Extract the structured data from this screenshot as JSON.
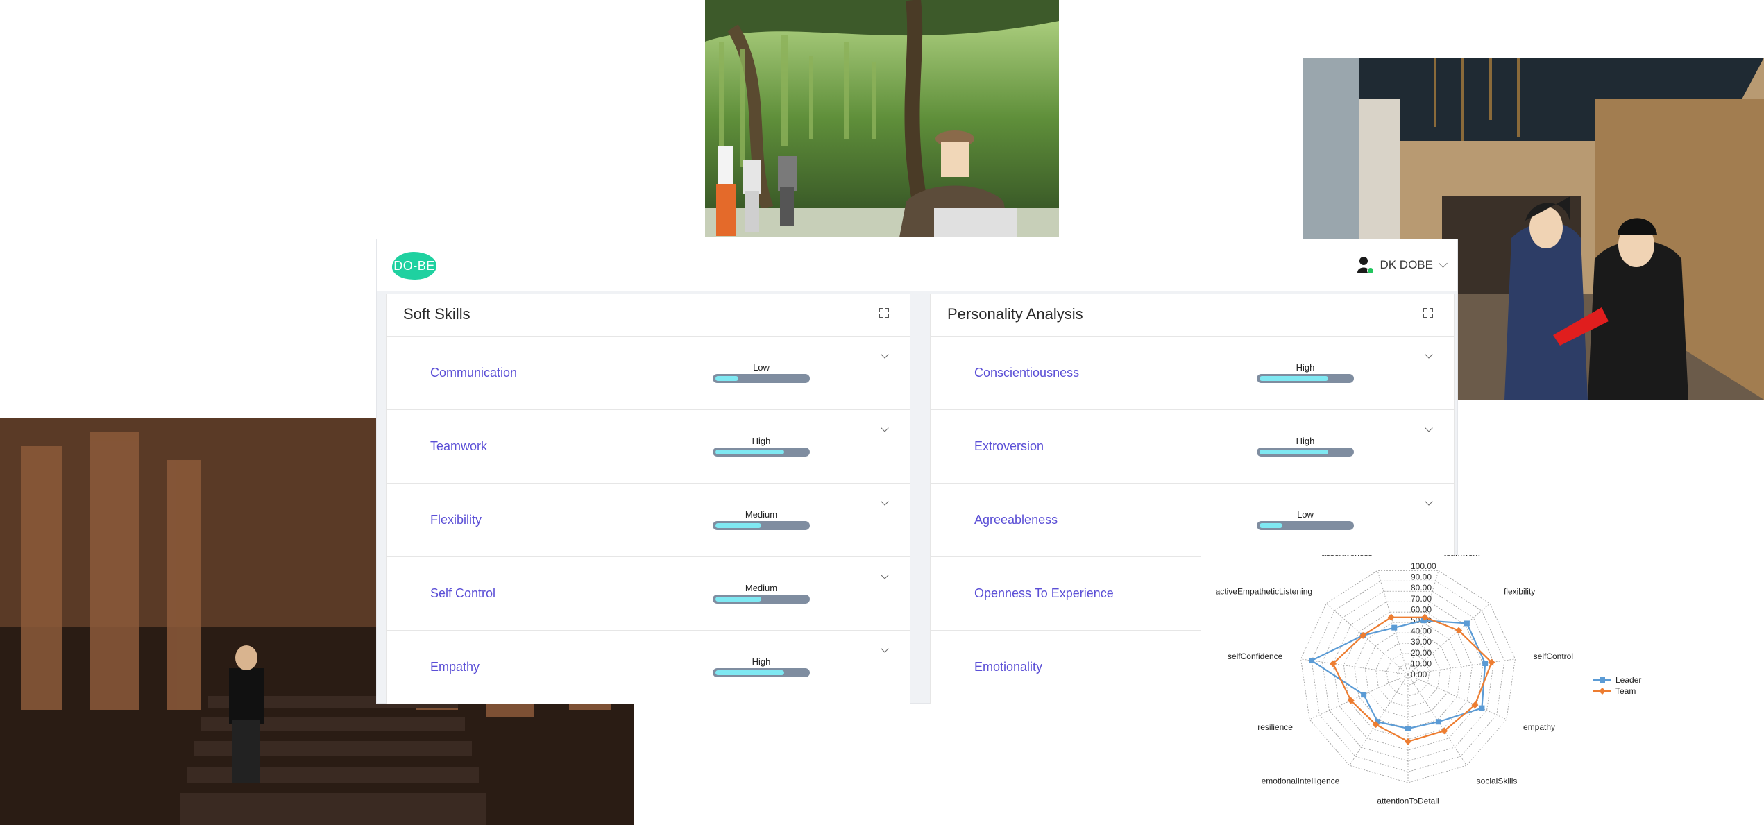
{
  "header": {
    "logo_text": "DO-BE",
    "user_name": "DK DOBE",
    "user_icon": "user-icon",
    "status_color": "#22c55e"
  },
  "soft_skills": {
    "title": "Soft Skills",
    "items": [
      {
        "label": "Communication",
        "level": "Low",
        "fill": 0.25
      },
      {
        "label": "Teamwork",
        "level": "High",
        "fill": 0.75
      },
      {
        "label": "Flexibility",
        "level": "Medium",
        "fill": 0.5
      },
      {
        "label": "Self Control",
        "level": "Medium",
        "fill": 0.5
      },
      {
        "label": "Empathy",
        "level": "High",
        "fill": 0.75
      }
    ]
  },
  "personality": {
    "title": "Personality Analysis",
    "items": [
      {
        "label": "Conscientiousness",
        "level": "High",
        "fill": 0.75
      },
      {
        "label": "Extroversion",
        "level": "High",
        "fill": 0.75
      },
      {
        "label": "Agreeableness",
        "level": "Low",
        "fill": 0.25
      },
      {
        "label": "Openness To Experience",
        "level": "",
        "fill": null
      },
      {
        "label": "Emotionality",
        "level": "",
        "fill": null
      }
    ]
  },
  "colors": {
    "accent_text": "#5b4fd6",
    "bar_track": "#7f8da0",
    "bar_fill": "#7fe8f2",
    "logo": "#1fd1a0",
    "leader": "#5b9bd5",
    "team": "#ed7d31"
  },
  "chart_data": {
    "type": "radar",
    "title": "",
    "axes": [
      "teamwork",
      "flexibility",
      "selfControl",
      "empathy",
      "socialSkills",
      "attentionToDetail",
      "emotionalIntelligence",
      "resilience",
      "selfConfidence",
      "activeEmpatheticListening",
      "assertiveness"
    ],
    "ticks": [
      "0.00",
      "10.00",
      "20.00",
      "30.00",
      "40.00",
      "50.00",
      "60.00",
      "70.00",
      "80.00",
      "90.00",
      "100.00"
    ],
    "rmin": 0,
    "rmax": 100,
    "series": [
      {
        "name": "Leader",
        "color": "#5b9bd5",
        "marker": "square",
        "values": [
          52,
          72,
          72,
          75,
          52,
          50,
          52,
          45,
          90,
          55,
          45
        ]
      },
      {
        "name": "Team",
        "color": "#ed7d31",
        "marker": "diamond",
        "values": [
          55,
          62,
          78,
          68,
          62,
          62,
          55,
          58,
          70,
          55,
          55
        ]
      }
    ],
    "legend": "right",
    "grid": true
  }
}
